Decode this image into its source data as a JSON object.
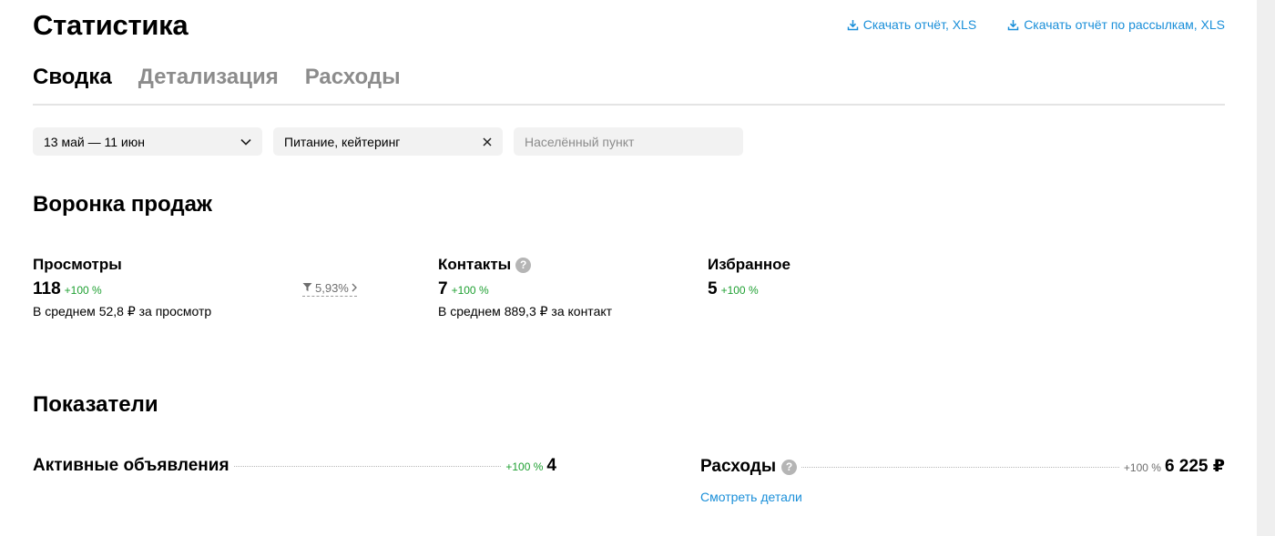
{
  "header": {
    "title": "Статистика",
    "downloads": [
      {
        "label": "Скачать отчёт, XLS",
        "icon": "download-icon"
      },
      {
        "label": "Скачать отчёт по рассылкам, XLS",
        "icon": "download-icon"
      }
    ]
  },
  "tabs": [
    {
      "label": "Сводка",
      "active": true
    },
    {
      "label": "Детализация",
      "active": false
    },
    {
      "label": "Расходы",
      "active": false
    }
  ],
  "filters": {
    "period": {
      "value": "13 май — 11 июн",
      "icon": "chevron-down-icon"
    },
    "category": {
      "value": "Питание, кейтеринг",
      "icon": "close-icon"
    },
    "location": {
      "placeholder": "Населённый пункт"
    }
  },
  "funnel": {
    "title": "Воронка продаж",
    "views": {
      "label": "Просмотры",
      "value": "118",
      "growth": "+100 %",
      "sub": "В среднем 52,8 ₽ за просмотр"
    },
    "conversion": {
      "value": "5,93%",
      "icon": "funnel-icon"
    },
    "contacts": {
      "label": "Контакты",
      "help": "?",
      "value": "7",
      "growth": "+100 %",
      "sub": "В среднем 889,3 ₽ за контакт"
    },
    "favorites": {
      "label": "Избранное",
      "value": "5",
      "growth": "+100 %"
    }
  },
  "metrics": {
    "title": "Показатели",
    "active_ads": {
      "label": "Активные объявления",
      "growth": "+100 %",
      "value": "4"
    },
    "expenses": {
      "label": "Расходы",
      "help": "?",
      "growth": "+100 %",
      "value": "6 225 ₽",
      "details_link": "Смотреть детали"
    }
  },
  "colors": {
    "accent": "#1a8fd9",
    "positive": "#1fa032",
    "muted": "#8c8c8c"
  }
}
